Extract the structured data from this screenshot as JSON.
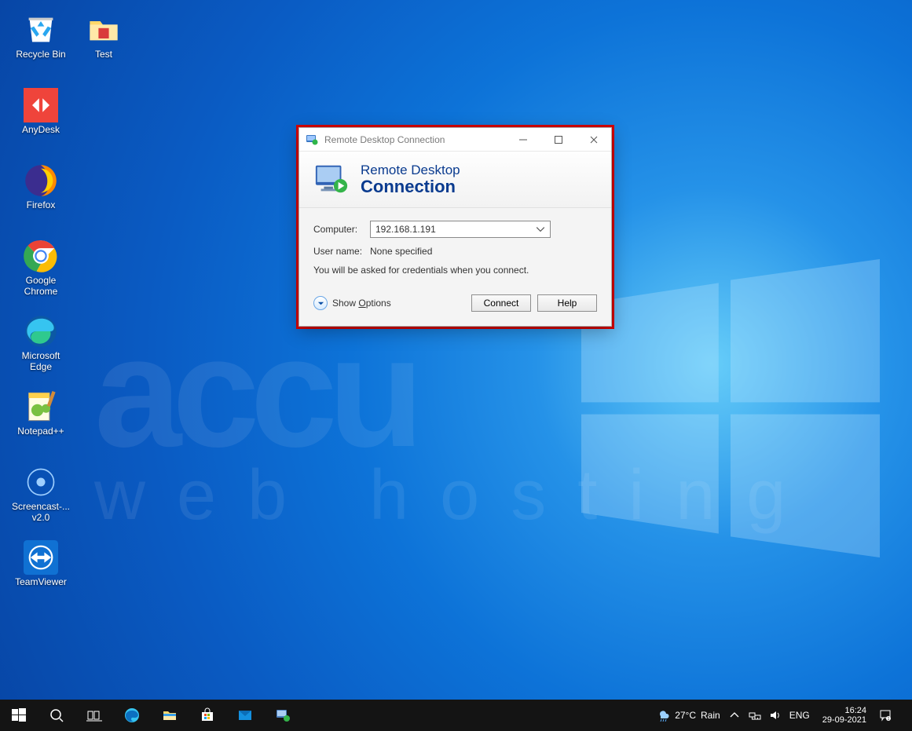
{
  "desktop_icons_col1": [
    {
      "label": "Recycle Bin",
      "icon": "recycle"
    },
    {
      "label": "AnyDesk",
      "icon": "anydesk"
    },
    {
      "label": "Firefox",
      "icon": "firefox"
    },
    {
      "label": "Google Chrome",
      "icon": "chrome"
    },
    {
      "label": "Microsoft Edge",
      "icon": "edge"
    },
    {
      "label": "Notepad++",
      "icon": "npp"
    },
    {
      "label": "Screencast-... v2.0",
      "icon": "screencast"
    },
    {
      "label": "TeamViewer",
      "icon": "teamviewer"
    }
  ],
  "desktop_icons_col2": [
    {
      "label": "Test",
      "icon": "folder"
    }
  ],
  "rdc": {
    "title": "Remote Desktop Connection",
    "banner_line1": "Remote Desktop",
    "banner_line2": "Connection",
    "computer_label": "Computer:",
    "computer_value": "192.168.1.191",
    "username_label": "User name:",
    "username_value": "None specified",
    "message": "You will be asked for credentials when you connect.",
    "show_options": "Show Options",
    "connect": "Connect",
    "help": "Help"
  },
  "taskbar": {
    "weather_temp": "27°C",
    "weather_cond": "Rain",
    "lang": "ENG",
    "time": "16:24",
    "date": "29-09-2021"
  },
  "watermark": {
    "accu": "accu",
    "web": "web  hosting"
  }
}
